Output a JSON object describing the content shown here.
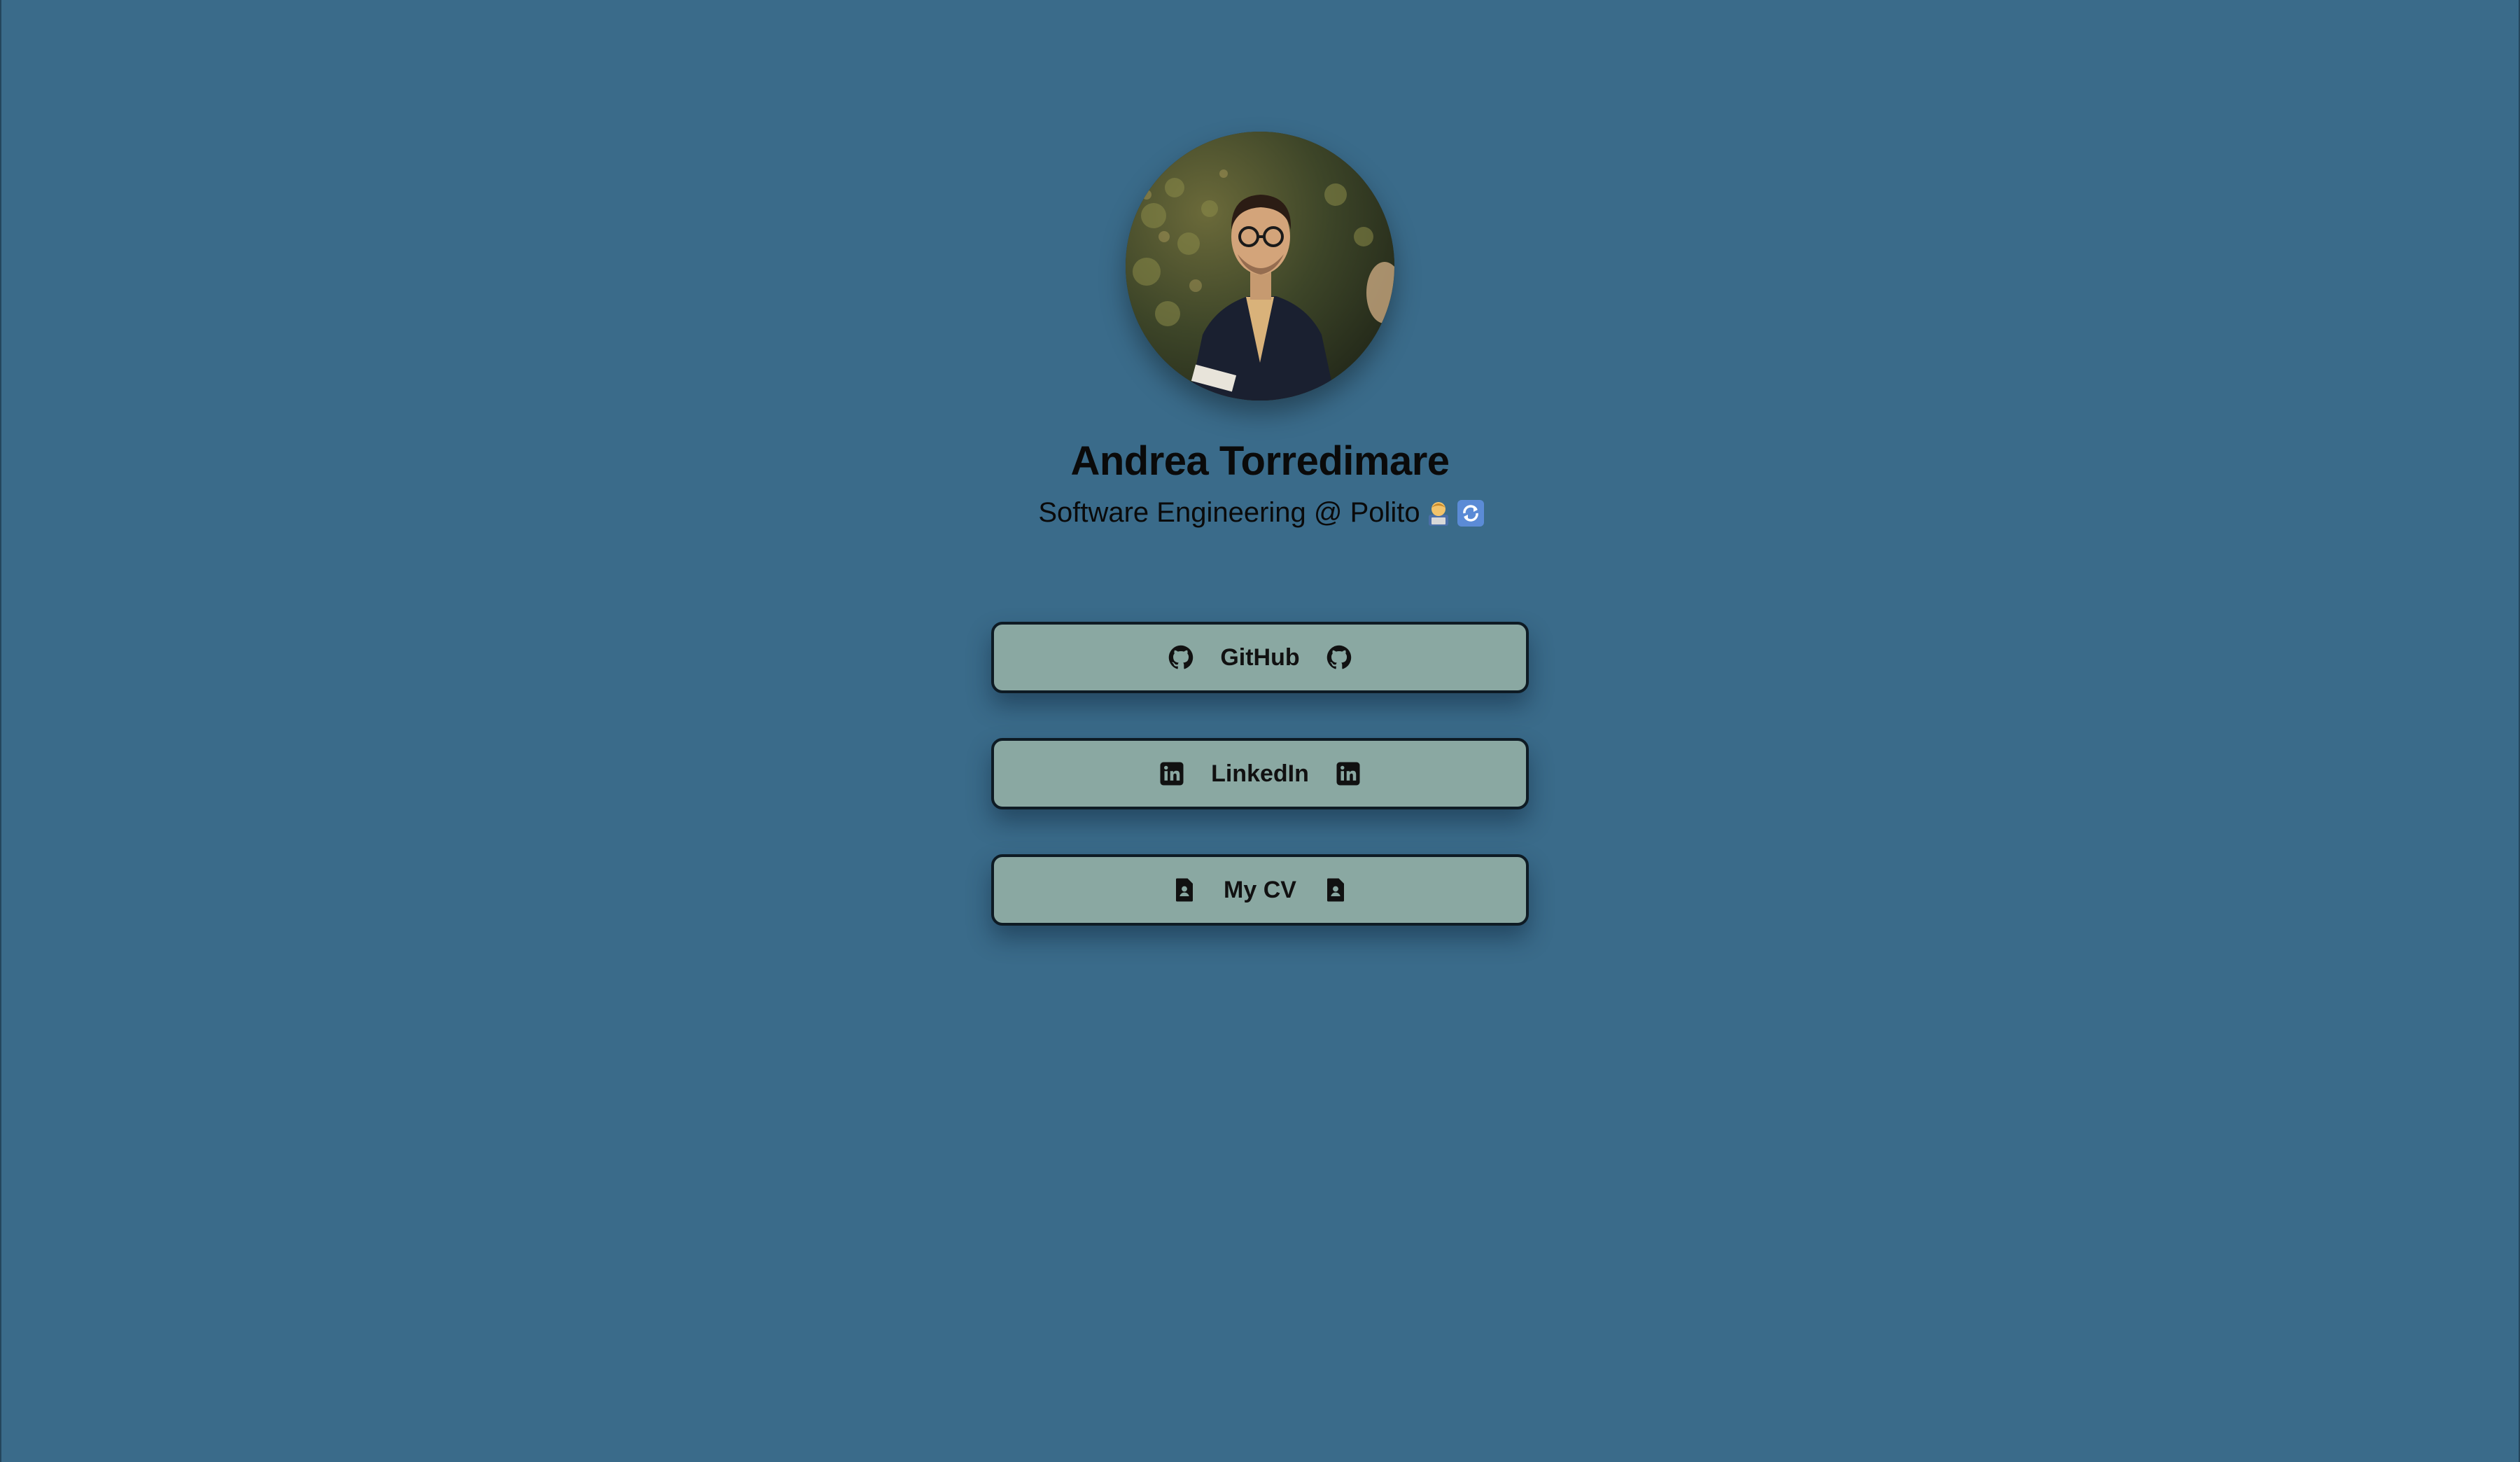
{
  "profile": {
    "name": "Andrea Torredimare",
    "tagline": "Software Engineering @ Polito",
    "tagline_emojis": [
      "technologist-emoji",
      "arrows-counterclockwise-emoji"
    ]
  },
  "links": [
    {
      "label": "GitHub",
      "icon": "github-icon"
    },
    {
      "label": "LinkedIn",
      "icon": "linkedin-icon"
    },
    {
      "label": "My CV",
      "icon": "document-icon"
    }
  ],
  "colors": {
    "background": "#3a6b8a",
    "button": "#8aa8a2",
    "button_border": "#0e1b24",
    "text": "#0a0a0a"
  }
}
